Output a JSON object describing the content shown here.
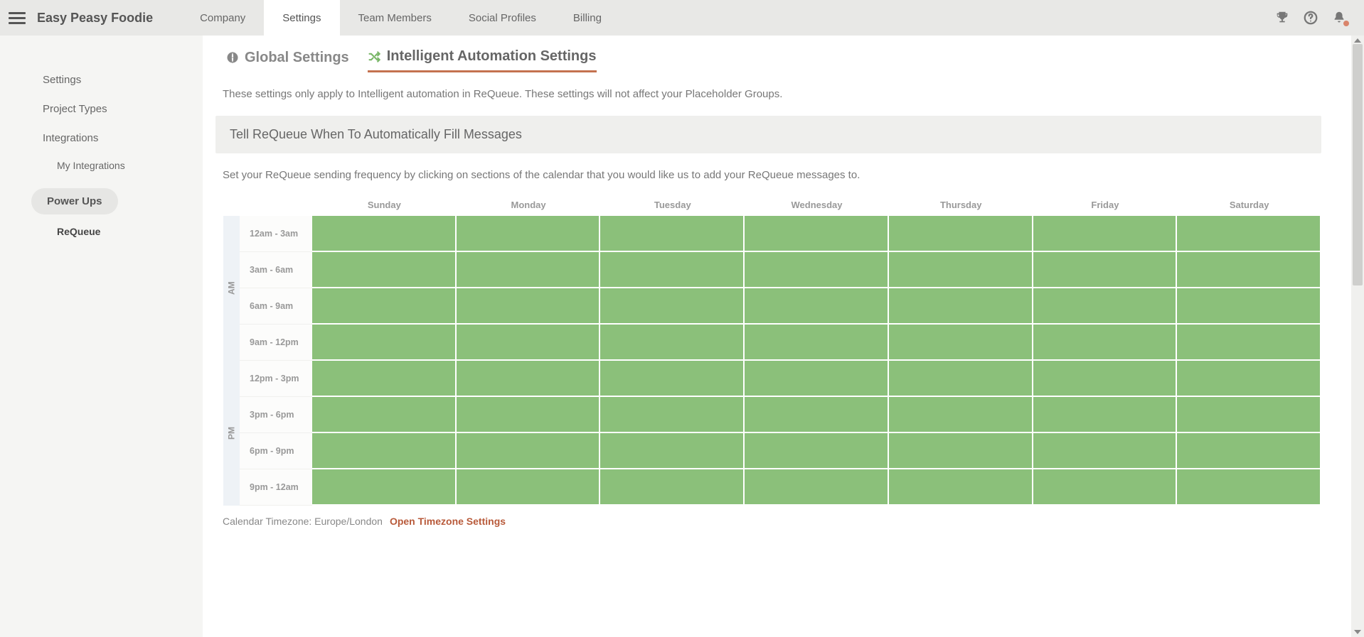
{
  "header": {
    "app_title": "Easy Peasy Foodie",
    "nav": [
      "Company",
      "Settings",
      "Team Members",
      "Social Profiles",
      "Billing"
    ],
    "active_nav_index": 1
  },
  "sidebar": {
    "items": [
      {
        "label": "Settings",
        "type": "item"
      },
      {
        "label": "Project Types",
        "type": "item"
      },
      {
        "label": "Integrations",
        "type": "item"
      },
      {
        "label": "My Integrations",
        "type": "subitem"
      },
      {
        "label": "Power Ups",
        "type": "pill"
      },
      {
        "label": "ReQueue",
        "type": "subitem",
        "active": true
      }
    ]
  },
  "tabs": {
    "global": "Global Settings",
    "intelligent": "Intelligent Automation Settings"
  },
  "description": "These settings only apply to Intelligent automation in ReQueue. These settings will not affect your Placeholder Groups.",
  "section_title": "Tell ReQueue When To Automatically Fill Messages",
  "sub_description": "Set your ReQueue sending frequency by clicking on sections of the calendar that you would like us to add your ReQueue messages to.",
  "calendar": {
    "days": [
      "Sunday",
      "Monday",
      "Tuesday",
      "Wednesday",
      "Thursday",
      "Friday",
      "Saturday"
    ],
    "row_labels_am": [
      "12am - 3am",
      "3am - 6am",
      "6am - 9am",
      "9am - 12pm"
    ],
    "row_labels_pm": [
      "12pm - 3pm",
      "3pm - 6pm",
      "6pm - 9pm",
      "9pm - 12am"
    ],
    "am_label": "AM",
    "pm_label": "PM"
  },
  "timezone": {
    "label": "Calendar Timezone: Europe/London",
    "link": "Open Timezone Settings"
  },
  "colors": {
    "slot_green": "#8bc07a",
    "accent_orange": "#c4724f"
  }
}
